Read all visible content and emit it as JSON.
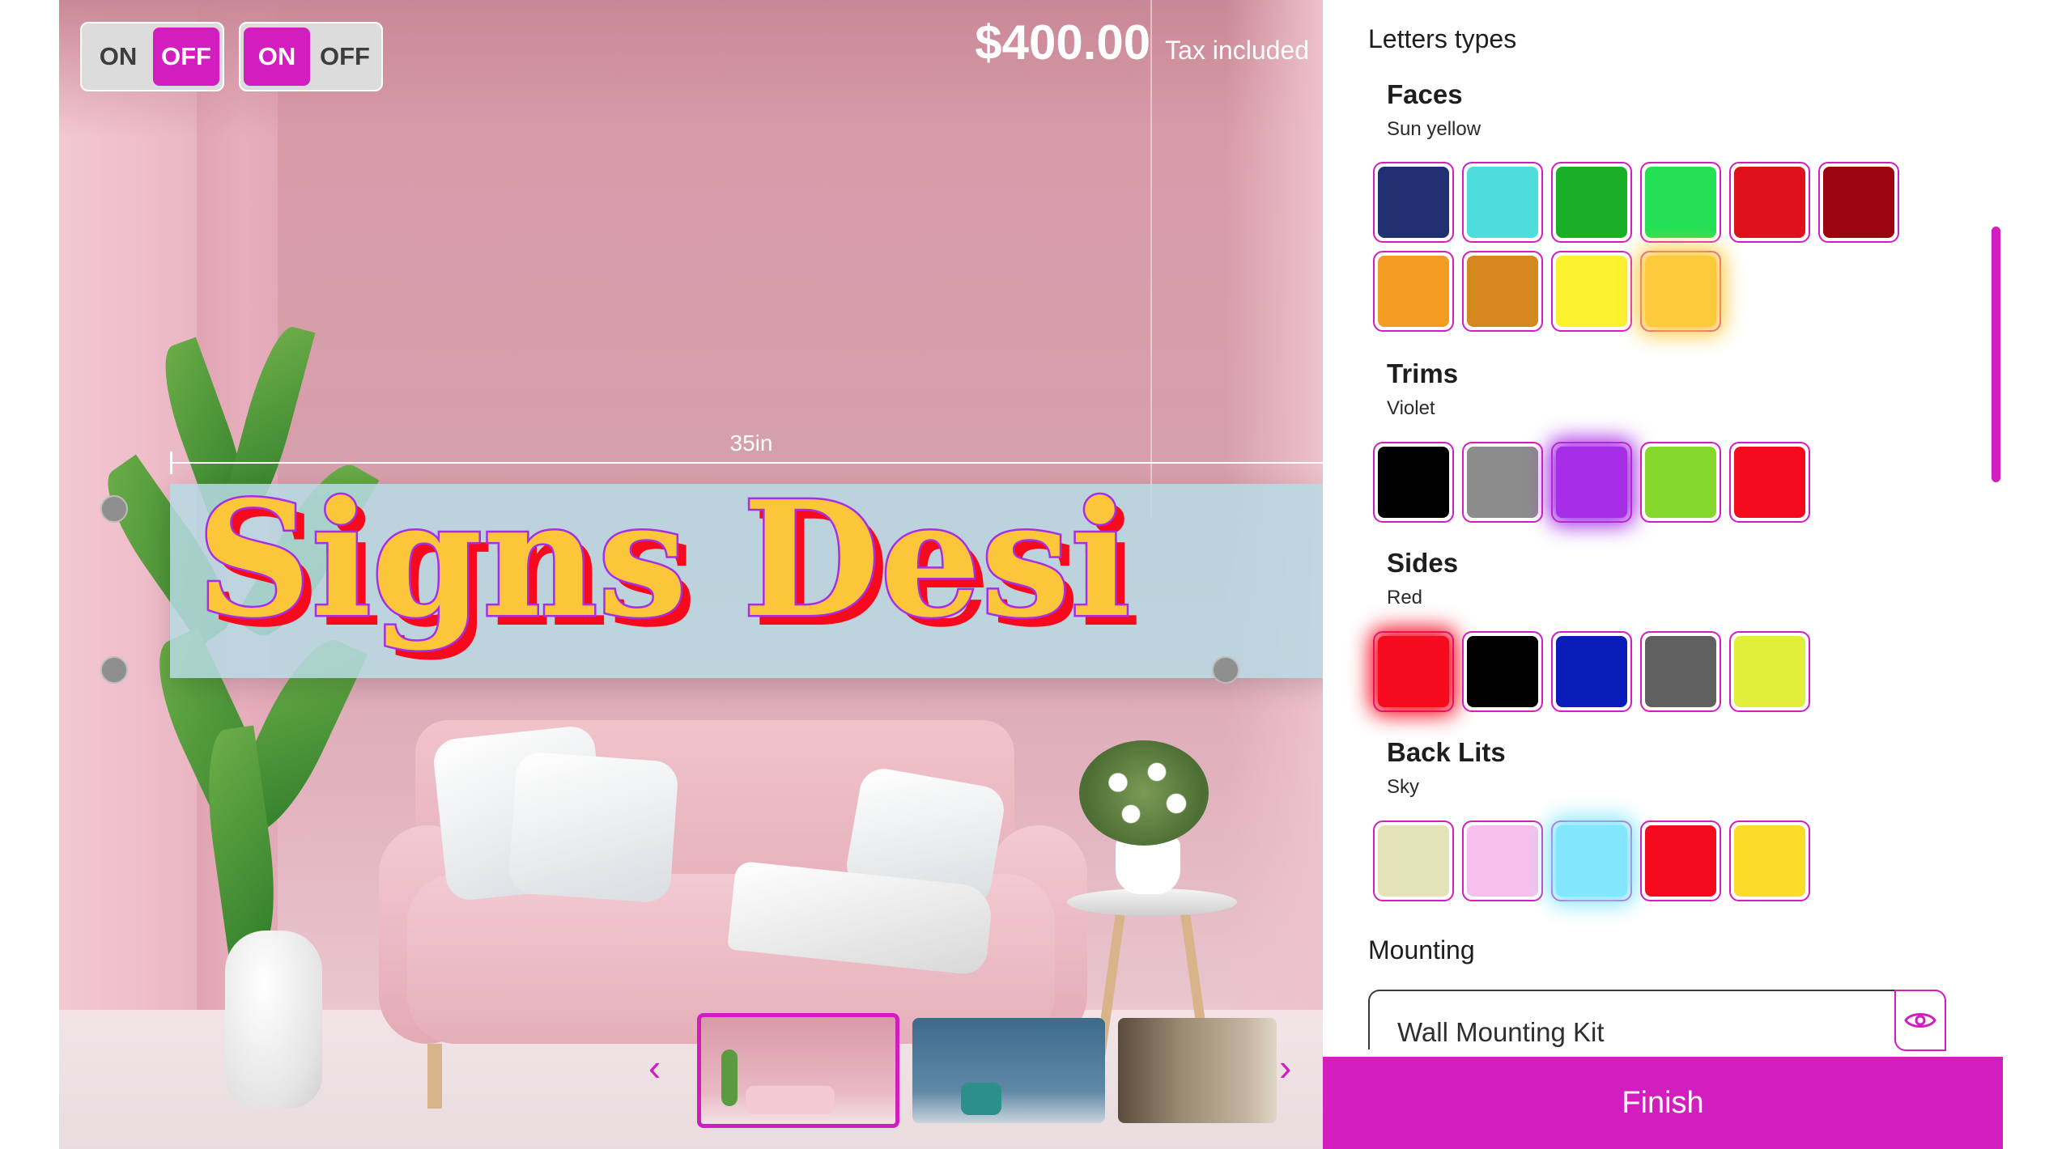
{
  "toggles": [
    {
      "on_label": "ON",
      "off_label": "OFF",
      "state": "off"
    },
    {
      "on_label": "ON",
      "off_label": "OFF",
      "state": "on"
    }
  ],
  "price": {
    "amount": "$400.00",
    "tax_note": "Tax included"
  },
  "sign": {
    "text": "Signs Desi",
    "width_label": "35in",
    "face_color": "#fcc63a",
    "trim_color": "#a52ee6",
    "side_color": "#f50a1e"
  },
  "thumbnails": [
    "thumb-pink-room",
    "thumb-blue-room",
    "thumb-wood-room"
  ],
  "nav": {
    "prev": "‹",
    "next": "›"
  },
  "panel": {
    "section_title": "Letters types",
    "groups": [
      {
        "title": "Faces",
        "selected": "Sun yellow",
        "swatches": [
          "#213070",
          "#4fdcdc",
          "#19b028",
          "#23e055",
          "#e0101c",
          "#9a050f",
          "#f39c23",
          "#d68820",
          "#fcf230",
          "#fcca3c"
        ],
        "selected_index": 9
      },
      {
        "title": "Trims",
        "selected": "Violet",
        "swatches": [
          "#000000",
          "#8c8c8c",
          "#a52ee6",
          "#85d82a",
          "#f50a1e"
        ],
        "selected_index": 2
      },
      {
        "title": "Sides",
        "selected": "Red",
        "swatches": [
          "#f50a1e",
          "#000000",
          "#0a1db8",
          "#606060",
          "#e0f03a"
        ],
        "selected_index": 0
      },
      {
        "title": "Back Lits",
        "selected": "Sky",
        "swatches": [
          "#e3e2b8",
          "#f7c0ec",
          "#82e6fc",
          "#f50a1e",
          "#fcdc28"
        ],
        "selected_index": 2
      }
    ],
    "mounting": {
      "title": "Mounting",
      "value": "Wall Mounting Kit"
    },
    "finish_label": "Finish"
  },
  "colors": {
    "accent": "#d21dbf"
  }
}
